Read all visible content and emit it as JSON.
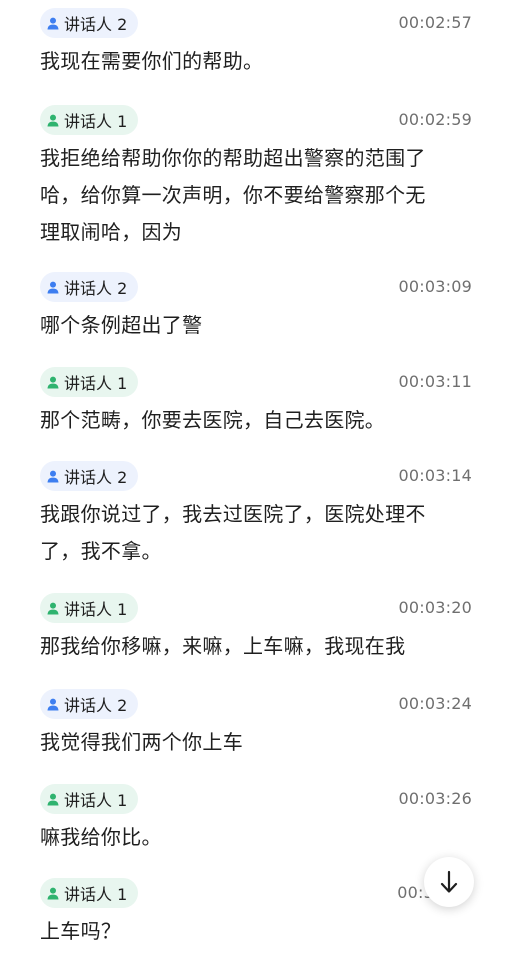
{
  "colors": {
    "speaker_1_badge_bg": "#e8f6ef",
    "speaker_1_icon": "#2fb36f",
    "speaker_2_badge_bg": "#edf2fd",
    "speaker_2_icon": "#3d7ef0",
    "text": "#1f1f1f",
    "timestamp": "#6f6f6f"
  },
  "entries": [
    {
      "speaker": "讲话人 2",
      "time": "00:02:57",
      "text": "我现在需要你们的帮助。"
    },
    {
      "speaker": "讲话人 1",
      "time": "00:02:59",
      "lines": [
        "我拒绝给帮助你你的帮助超出警察的范围了",
        "哈，给你算一次声明，你不要给警察那个无",
        "理取闹哈，因为"
      ]
    },
    {
      "speaker": "讲话人 2",
      "time": "00:03:09",
      "text": "哪个条例超出了警"
    },
    {
      "speaker": "讲话人 1",
      "time": "00:03:11",
      "text": "那个范畴，你要去医院，自己去医院。"
    },
    {
      "speaker": "讲话人 2",
      "time": "00:03:14",
      "lines": [
        "我跟你说过了，我去过医院了，医院处理不",
        "了，我不拿。"
      ]
    },
    {
      "speaker": "讲话人 1",
      "time": "00:03:20",
      "text": "那我给你移嘛，来嘛，上车嘛，我现在我"
    },
    {
      "speaker": "讲话人 2",
      "time": "00:03:24",
      "text": "我觉得我们两个你上车"
    },
    {
      "speaker": "讲话人 1",
      "time": "00:03:26",
      "text": "嘛我给你比。"
    },
    {
      "speaker": "讲话人 1",
      "time": "00:3",
      "text": "上车吗？"
    }
  ],
  "scroll_button": {
    "icon": "arrow-down-icon"
  }
}
